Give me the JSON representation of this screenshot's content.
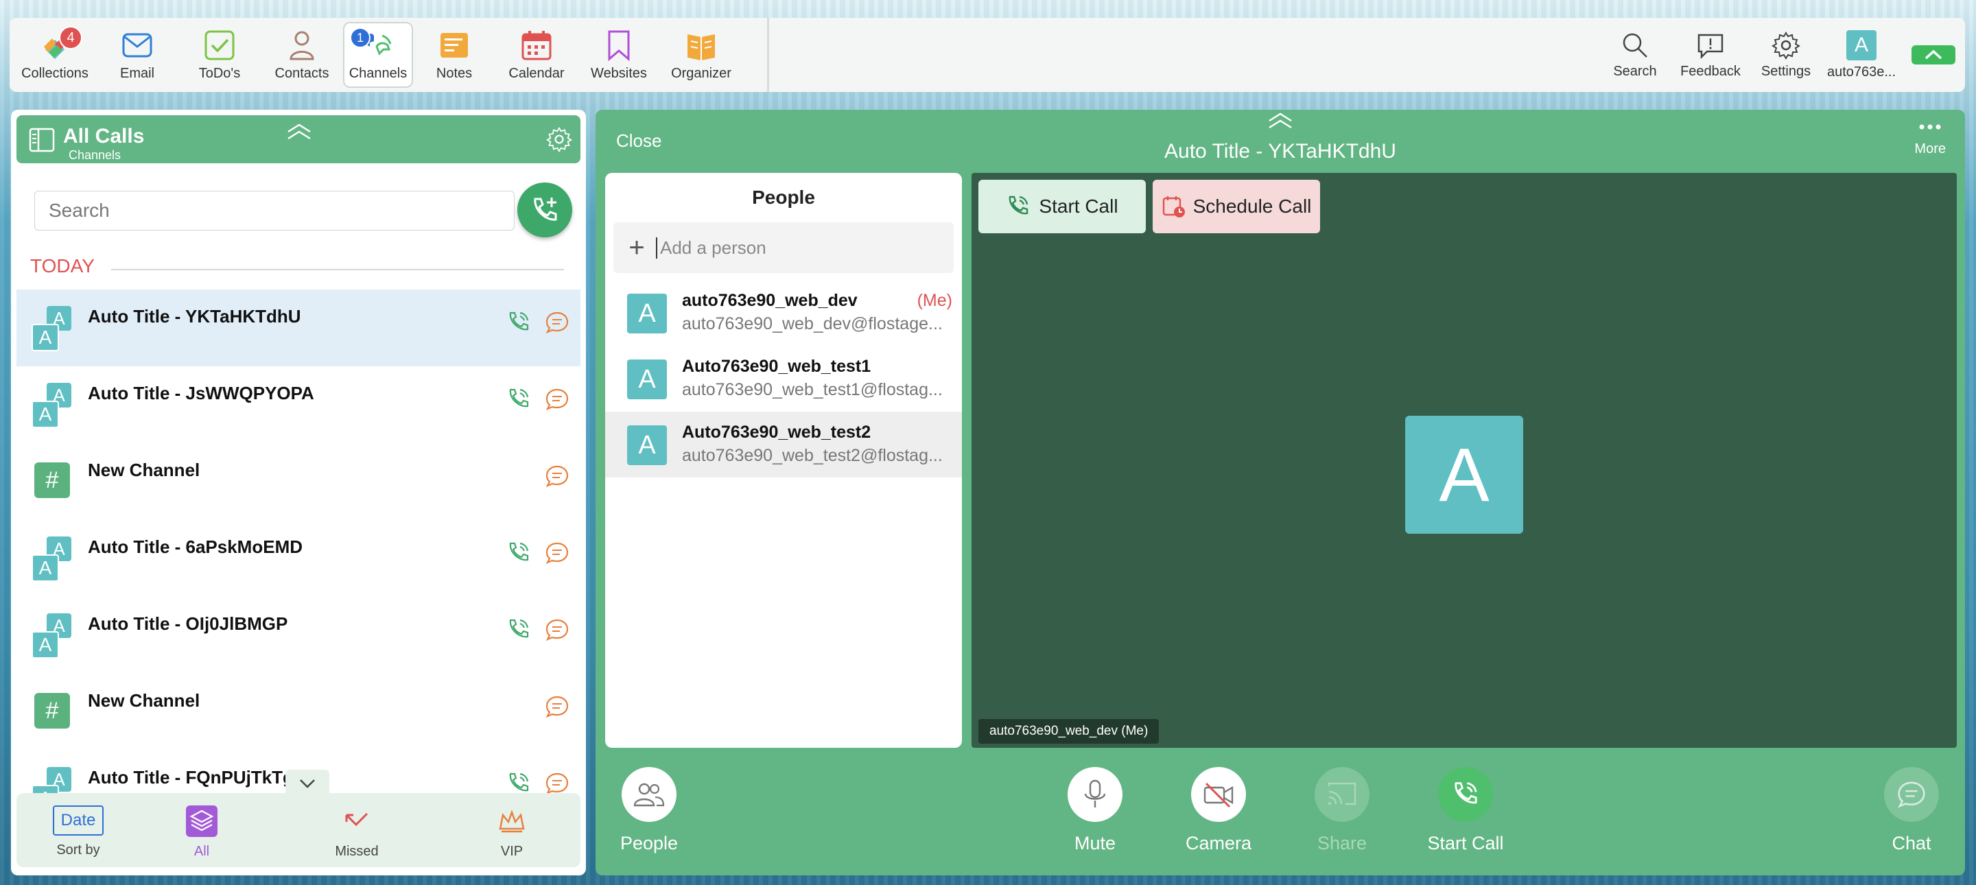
{
  "toolbar": {
    "apps": [
      {
        "label": "Collections",
        "badge": "4"
      },
      {
        "label": "Email"
      },
      {
        "label": "ToDo's"
      },
      {
        "label": "Contacts"
      },
      {
        "label": "Channels",
        "badge": "1"
      },
      {
        "label": "Notes"
      },
      {
        "label": "Calendar"
      },
      {
        "label": "Websites"
      },
      {
        "label": "Organizer"
      }
    ],
    "right": {
      "search": "Search",
      "feedback": "Feedback",
      "settings": "Settings",
      "account": "auto763e...",
      "avatar_letter": "A"
    }
  },
  "left": {
    "header_title": "All Calls",
    "header_sub": "Channels",
    "search_placeholder": "Search",
    "section": "TODAY",
    "rows": [
      {
        "title": "Auto Title - YKTaHKTdhU",
        "type": "group"
      },
      {
        "title": "Auto Title - JsWWQPYOPA",
        "type": "group"
      },
      {
        "title": "New Channel",
        "type": "channel"
      },
      {
        "title": "Auto Title - 6aPskMoEMD",
        "type": "group"
      },
      {
        "title": "Auto Title - OIj0JlBMGP",
        "type": "group"
      },
      {
        "title": "New Channel",
        "type": "channel"
      },
      {
        "title": "Auto Title - FQnPUjTkTg",
        "type": "group"
      }
    ],
    "footer": {
      "sort_value": "Date",
      "sort_label": "Sort by",
      "all": "All",
      "missed": "Missed",
      "vip": "VIP"
    }
  },
  "right": {
    "close": "Close",
    "title": "Auto Title - YKTaHKTdhU",
    "more": "More",
    "people_header": "People",
    "add_placeholder": "Add a person",
    "people": [
      {
        "name": "auto763e90_web_dev",
        "email": "auto763e90_web_dev@flostage...",
        "me": "(Me)"
      },
      {
        "name": "Auto763e90_web_test1",
        "email": "auto763e90_web_test1@flostag..."
      },
      {
        "name": "Auto763e90_web_test2",
        "email": "auto763e90_web_test2@flostag..."
      }
    ],
    "start_call": "Start Call",
    "schedule_call": "Schedule Call",
    "video_avatar": "A",
    "name_tag": "auto763e90_web_dev (Me)",
    "controls": {
      "people": "People",
      "mute": "Mute",
      "camera": "Camera",
      "share": "Share",
      "start_call": "Start Call",
      "chat": "Chat"
    }
  },
  "colors": {
    "panel_green": "#62b584",
    "video_bg": "#365d48",
    "avatar": "#5fbfc2",
    "badge_red": "#e05252",
    "accent_blue": "#2f6fd6"
  }
}
